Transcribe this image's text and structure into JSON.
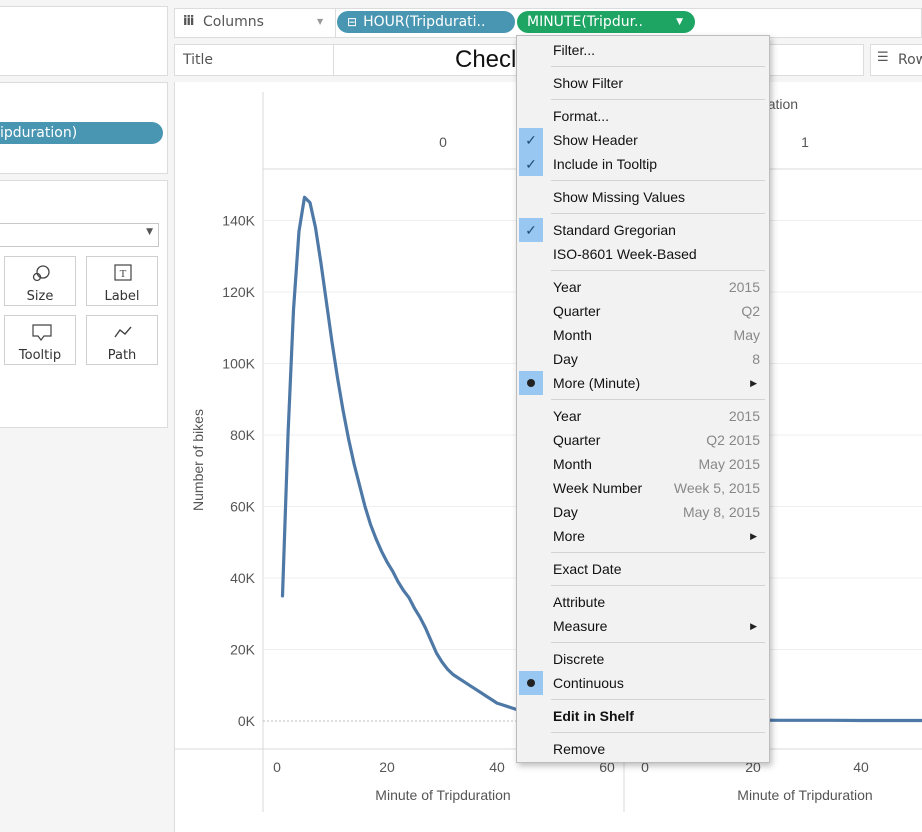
{
  "shelves": {
    "columns_label": "Columns",
    "pill_hour": "HOUR(Tripdurati..",
    "pill_minute": "MINUTE(Tripdur..",
    "title_label": "Title",
    "title_text": "Checl",
    "rows_label": "Row"
  },
  "left": {
    "rows_pill": "ipduration)",
    "marks": [
      {
        "label": "Size",
        "icon": "size-icon"
      },
      {
        "label": "Label",
        "icon": "label-icon"
      },
      {
        "label": "Tooltip",
        "icon": "tooltip-icon"
      },
      {
        "label": "Path",
        "icon": "path-icon"
      }
    ]
  },
  "chart": {
    "header_field": "ripduration",
    "header_left": "0",
    "header_right": "1",
    "ylabel": "Number of bikes",
    "xlabel_left": "Minute of Tripduration",
    "xlabel_right": "Minute of Tripduration",
    "color": "#4e79a7"
  },
  "chart_data": {
    "type": "line",
    "ylabel": "Number of bikes",
    "xlabel": "Minute of Tripduration",
    "ylim": [
      0,
      150000
    ],
    "yticks": [
      "0K",
      "20K",
      "40K",
      "60K",
      "80K",
      "100K",
      "120K",
      "140K"
    ],
    "panes": [
      {
        "header": "0",
        "xticks": [
          "0",
          "20",
          "40",
          "60"
        ],
        "xlim": [
          0,
          60
        ],
        "x": [
          1,
          2,
          3,
          4,
          5,
          6,
          7,
          8,
          9,
          10,
          11,
          12,
          13,
          14,
          15,
          16,
          17,
          18,
          19,
          20,
          21,
          22,
          23,
          24,
          25,
          26,
          27,
          28,
          29,
          30,
          31,
          32,
          33,
          34,
          35,
          36,
          37,
          38,
          39,
          40,
          41,
          42,
          43,
          44
        ],
        "values": [
          35000,
          80000,
          115000,
          137000,
          146500,
          145000,
          138000,
          128000,
          117000,
          106000,
          96000,
          87000,
          79000,
          72000,
          66000,
          60000,
          55000,
          51000,
          47500,
          44500,
          42000,
          39000,
          36500,
          34500,
          31500,
          29000,
          26000,
          22500,
          19000,
          16500,
          14500,
          13000,
          12000,
          11000,
          10000,
          9000,
          8000,
          7000,
          6000,
          5000,
          4500,
          4000,
          3500,
          3000
        ]
      },
      {
        "header": "1",
        "xticks": [
          "0",
          "20",
          "40"
        ],
        "xlim": [
          0,
          60
        ],
        "x": [
          0,
          5,
          10,
          15,
          20,
          25,
          30,
          35,
          40,
          45,
          50,
          55
        ],
        "values": [
          300,
          300,
          250,
          250,
          250,
          200,
          200,
          200,
          150,
          150,
          150,
          150
        ]
      }
    ]
  },
  "menu": {
    "items": [
      {
        "label": "Filter..."
      },
      {
        "label": "Show Filter"
      },
      {
        "label": "Format..."
      },
      {
        "label": "Show Header"
      },
      {
        "label": "Include in Tooltip"
      },
      {
        "label": "Show Missing Values"
      },
      {
        "label": "Standard Gregorian"
      },
      {
        "label": "ISO-8601 Week-Based"
      },
      {
        "label": "Year",
        "value": "2015"
      },
      {
        "label": "Quarter",
        "value": "Q2"
      },
      {
        "label": "Month",
        "value": "May"
      },
      {
        "label": "Day",
        "value": "8"
      },
      {
        "label": "More (Minute)"
      },
      {
        "label": "Year",
        "value": "2015"
      },
      {
        "label": "Quarter",
        "value": "Q2 2015"
      },
      {
        "label": "Month",
        "value": "May 2015"
      },
      {
        "label": "Week Number",
        "value": "Week 5, 2015"
      },
      {
        "label": "Day",
        "value": "May 8, 2015"
      },
      {
        "label": "More"
      },
      {
        "label": "Exact Date"
      },
      {
        "label": "Attribute"
      },
      {
        "label": "Measure"
      },
      {
        "label": "Discrete"
      },
      {
        "label": "Continuous"
      },
      {
        "label": "Edit in Shelf"
      },
      {
        "label": "Remove"
      }
    ]
  },
  "colors": {
    "pill_hour": "#4996b2",
    "pill_minute": "#1ea564",
    "check_bg": "#98c8f2"
  }
}
